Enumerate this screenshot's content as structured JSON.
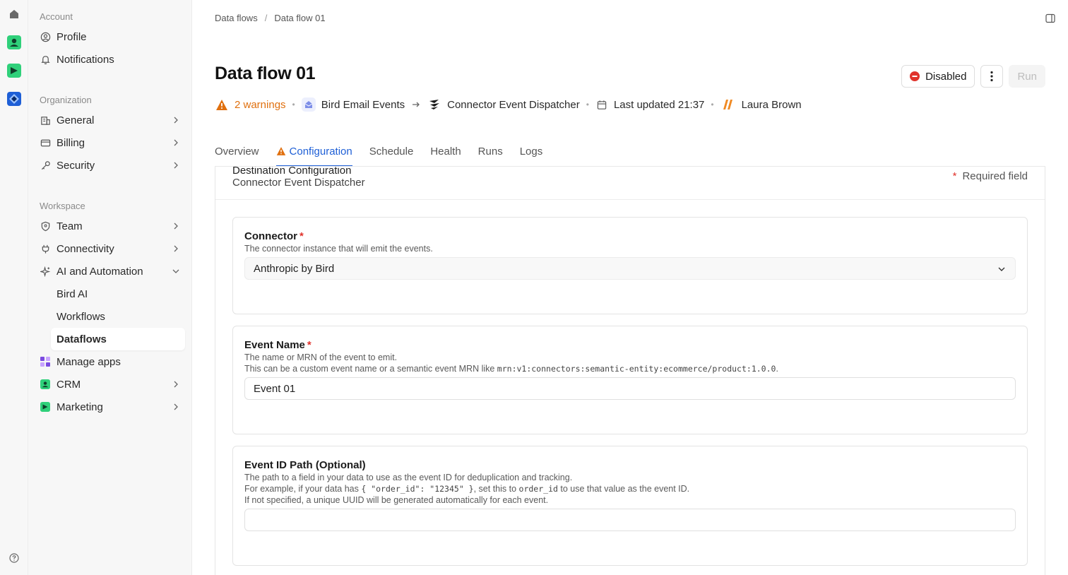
{
  "breadcrumb": {
    "root": "Data flows",
    "current": "Data flow 01"
  },
  "page": {
    "title": "Data flow 01"
  },
  "meta": {
    "warnings": "2 warnings",
    "source": "Bird Email Events",
    "destination": "Connector Event Dispatcher",
    "updated": "Last updated 21:37",
    "user": "Laura Brown"
  },
  "actions": {
    "status": "Disabled",
    "run": "Run"
  },
  "tabs": [
    "Overview",
    "Configuration",
    "Schedule",
    "Health",
    "Runs",
    "Logs"
  ],
  "sidebar": {
    "account_label": "Account",
    "account": [
      "Profile",
      "Notifications"
    ],
    "org_label": "Organization",
    "org": [
      "General",
      "Billing",
      "Security"
    ],
    "workspace_label": "Workspace",
    "workspace": [
      "Team",
      "Connectivity",
      "AI and Automation"
    ],
    "ai_sub": [
      "Bird AI",
      "Workflows",
      "Dataflows"
    ],
    "apps": [
      "Manage apps",
      "CRM",
      "Marketing"
    ]
  },
  "destination": {
    "title": "Destination Configuration",
    "subtitle": "Connector Event Dispatcher",
    "required_note": "Required field"
  },
  "connector": {
    "label": "Connector",
    "help": "The connector instance that will emit the events.",
    "value": "Anthropic by Bird"
  },
  "event_name": {
    "label": "Event Name",
    "help1": "The name or MRN of the event to emit.",
    "help2_prefix": "This can be a custom event name or a semantic event MRN like ",
    "help2_code": "mrn:v1:connectors:semantic-entity:ecommerce/product:1.0.0",
    "help2_suffix": ".",
    "value": "Event 01"
  },
  "event_id": {
    "label": "Event ID Path (Optional)",
    "help1": "The path to a field in your data to use as the event ID for deduplication and tracking.",
    "help2_prefix": "For example, if your data has ",
    "help2_code1": "{ \"order_id\": \"12345\" }",
    "help2_mid": ", set this to ",
    "help2_code2": "order_id",
    "help2_suffix": " to use that value as the event ID.",
    "help3": "If not specified, a unique UUID will be generated automatically for each event.",
    "value": ""
  },
  "colors": {
    "accent": "#1e5fd6",
    "warning": "#e0700f",
    "required": "#e0332c",
    "disabled": "#e0332c"
  }
}
